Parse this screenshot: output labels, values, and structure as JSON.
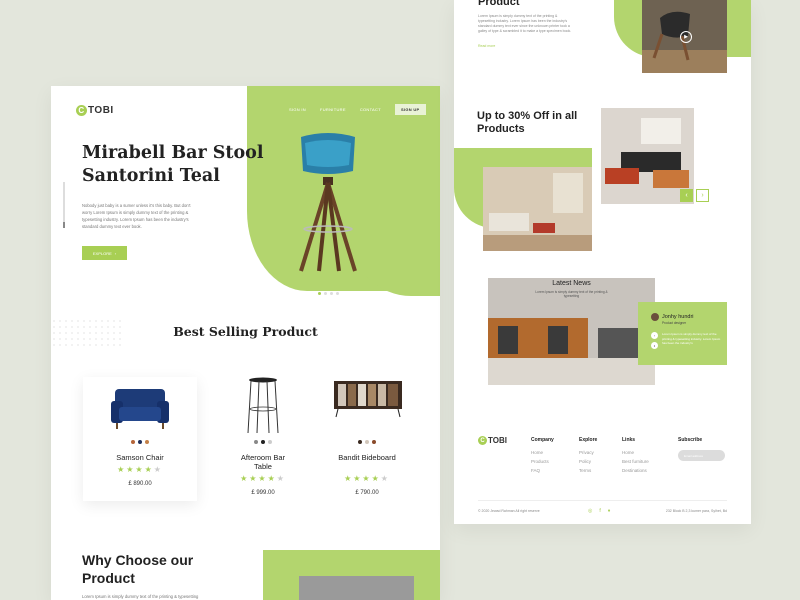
{
  "left": {
    "logo": {
      "mark": "C",
      "text": "TOBI"
    },
    "nav": [
      "SIGN IN",
      "FURNITURE",
      "CONTACT"
    ],
    "signup_label": "SIGN UP",
    "hero": {
      "title": "Mirabell Bar Stool Santorini Teal",
      "description": "Nobody just baby is a sumer unless it's this baby. But don't worry Lorem Ipsum is simply dummy text of the printing & typesetting industry. Lorem Ipsum has been the industry's standard dummy text ever book.",
      "button_label": "EXPLORE",
      "button_icon": "chevron-right-icon"
    },
    "best_selling": {
      "title": "Best Selling Product",
      "products": [
        {
          "name": "Samson Chair",
          "price": "£ 890.00",
          "rating": 4,
          "swatches": [
            "#b5653a",
            "#1e2f5c",
            "#c48148"
          ]
        },
        {
          "name": "Afteroom Bar Table",
          "price": "£ 999.00",
          "rating": 4,
          "swatches": [
            "#888888",
            "#222222",
            "#cccccc"
          ]
        },
        {
          "name": "Bandit Bideboard",
          "price": "£ 790.00",
          "rating": 4,
          "swatches": [
            "#3a2a20",
            "#d2c7bb",
            "#8a4b2b"
          ]
        }
      ]
    },
    "why": {
      "title": "Why Choose our Product",
      "description": "Lorem Ipsum is simply dummy text of the printing & typesetting"
    }
  },
  "right": {
    "top": {
      "title": "Product",
      "description": "Lorem Ipsum is simply dummy text of the printing & typesetting industry. Lorem Ipsum has been the industry's standard dummy text ever since the unknown printer took a galley of type & scrambled it to make a type specimen book.",
      "link": "Read more"
    },
    "offer": {
      "title": "Up to 30% Off in all Products"
    },
    "news": {
      "title": "Latest News",
      "description": "Lorem Ipsum is simply dummy text of the printing & typesetting",
      "testimonial": {
        "name": "Jonhy hundri",
        "role": "Product designer",
        "text": "Lorem Ipsum is simply dummy text of the printing & typesetting industry. Lorem Ipsum has been the industry's"
      }
    },
    "footer": {
      "logo": {
        "mark": "C",
        "text": "TOBI"
      },
      "columns": [
        {
          "heading": "Company",
          "items": [
            "Home",
            "Products",
            "FAQ"
          ]
        },
        {
          "heading": "Explore",
          "items": [
            "Privacy",
            "Policy",
            "Terms"
          ]
        },
        {
          "heading": "Links",
          "items": [
            "Home",
            "Best furniture",
            "Destinations"
          ]
        }
      ],
      "subscribe_heading": "Subscribe",
      "subscribe_placeholder": "Email address",
      "copyright": "© 2020 Jewad Rahman All right reserve",
      "address": "232 Block B 2,3 kumer para, Sylhet, Bd"
    }
  },
  "colors": {
    "accent": "#b3d56e",
    "accent_dark": "#a8cf54"
  }
}
